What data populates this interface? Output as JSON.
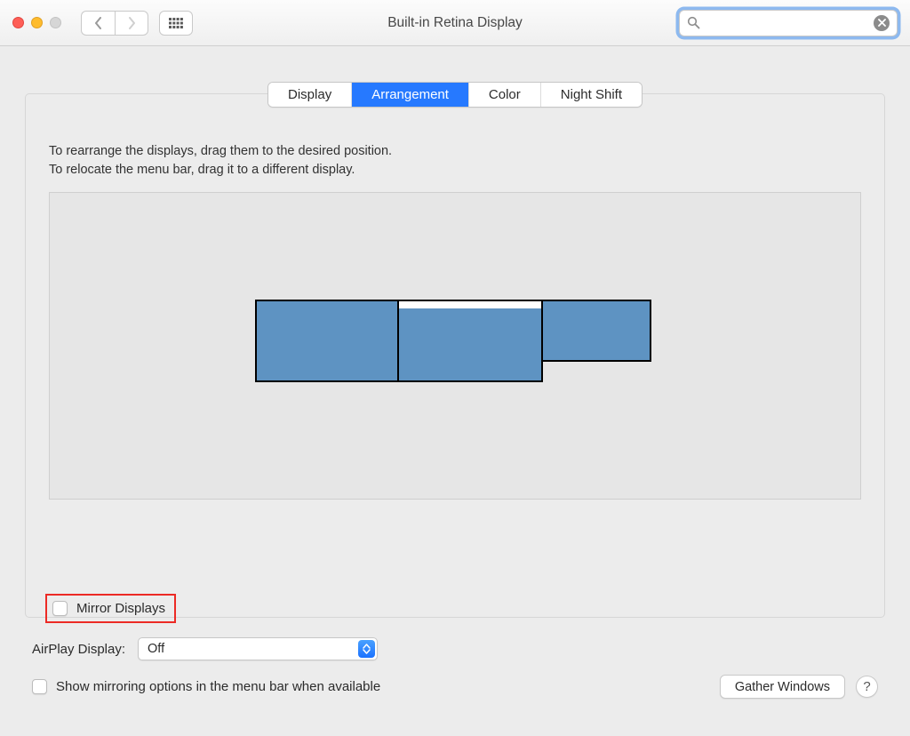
{
  "window": {
    "title": "Built-in Retina Display"
  },
  "search": {
    "placeholder": ""
  },
  "tabs": [
    {
      "label": "Display"
    },
    {
      "label": "Arrangement"
    },
    {
      "label": "Color"
    },
    {
      "label": "Night Shift"
    }
  ],
  "instructions": {
    "line1": "To rearrange the displays, drag them to the desired position.",
    "line2": "To relocate the menu bar, drag it to a different display."
  },
  "mirror": {
    "label": "Mirror Displays"
  },
  "airplay": {
    "label": "AirPlay Display:",
    "value": "Off"
  },
  "show_mirroring": {
    "label": "Show mirroring options in the menu bar when available"
  },
  "gather": {
    "label": "Gather Windows"
  },
  "help": {
    "label": "?"
  }
}
